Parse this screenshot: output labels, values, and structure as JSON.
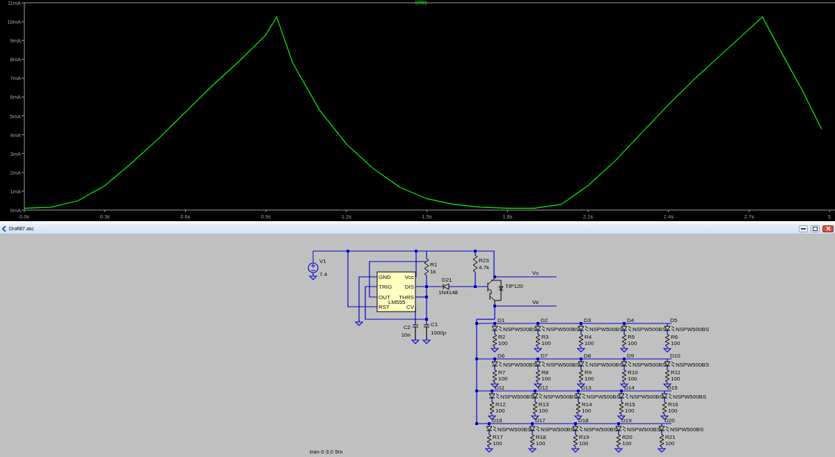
{
  "plot": {
    "chart_data": {
      "type": "line",
      "xlim": [
        0,
        3.02
      ],
      "ylim": [
        0,
        11
      ],
      "xticks": [
        {
          "value": 0,
          "label": "0.0s"
        },
        {
          "value": 0.3,
          "label": "0.3s"
        },
        {
          "value": 0.6,
          "label": "0.6s"
        },
        {
          "value": 0.9,
          "label": "0.9s"
        },
        {
          "value": 1.2,
          "label": "1.2s"
        },
        {
          "value": 1.5,
          "label": "1.5s"
        },
        {
          "value": 1.8,
          "label": "1.8s"
        },
        {
          "value": 2.1,
          "label": "2.1s"
        },
        {
          "value": 2.4,
          "label": "2.4s"
        },
        {
          "value": 2.7,
          "label": "2.7s"
        },
        {
          "value": 3.0,
          "label": "3."
        }
      ],
      "yticks": [
        {
          "value": 0,
          "label": "0mA"
        },
        {
          "value": 1,
          "label": "1mA"
        },
        {
          "value": 2,
          "label": "2mA"
        },
        {
          "value": 3,
          "label": "3mA"
        },
        {
          "value": 4,
          "label": "4mA"
        },
        {
          "value": 5,
          "label": "5mA"
        },
        {
          "value": 6,
          "label": "6mA"
        },
        {
          "value": 7,
          "label": "7mA"
        },
        {
          "value": 8,
          "label": "8mA"
        },
        {
          "value": 9,
          "label": "9mA"
        },
        {
          "value": 10,
          "label": "10mA"
        },
        {
          "value": 11,
          "label": "11mA"
        }
      ],
      "x": [
        0,
        0.1,
        0.2,
        0.3,
        0.4,
        0.5,
        0.6,
        0.7,
        0.8,
        0.9,
        0.94,
        1.0,
        1.1,
        1.2,
        1.3,
        1.4,
        1.5,
        1.6,
        1.7,
        1.8,
        1.9,
        2.0,
        2.1,
        2.2,
        2.3,
        2.4,
        2.5,
        2.6,
        2.7,
        2.75,
        2.8,
        2.9,
        2.97
      ],
      "series": [
        {
          "name": "I(Rb)",
          "color": "#00ff00",
          "values": [
            0.1,
            0.15,
            0.5,
            1.3,
            2.5,
            3.8,
            5.2,
            6.6,
            7.9,
            9.3,
            10.25,
            7.8,
            5.3,
            3.5,
            2.2,
            1.2,
            0.6,
            0.3,
            0.15,
            0.1,
            0.1,
            0.3,
            1.3,
            2.6,
            4.1,
            5.6,
            7.0,
            8.3,
            9.6,
            10.25,
            8.9,
            6.3,
            4.3
          ]
        }
      ]
    }
  },
  "schematic_window": {
    "title": "Draft87.asc",
    "source": {
      "designator": "V1",
      "value": "7.4"
    },
    "ic": {
      "part": "LM555",
      "left_pins": [
        "GND",
        "TRIG",
        "OUT",
        "RST"
      ],
      "right_pins": [
        "Vcc",
        "DIS",
        "THRS",
        "CV"
      ]
    },
    "r1": {
      "designator": "R1",
      "value": "1k"
    },
    "r23": {
      "designator": "R23",
      "value": "4.7k"
    },
    "diode": {
      "designator": "D21",
      "model": "1N4148"
    },
    "transistor": {
      "model": "TIP120"
    },
    "c1": {
      "designator": "C1",
      "value": "1000p"
    },
    "c2": {
      "designator": "C2",
      "value": "10n"
    },
    "net_labels": [
      "Vc",
      "Ve"
    ],
    "led_rows": [
      {
        "leds": [
          {
            "designator": "D1",
            "model": "NSPW500BS",
            "resistor": "R2",
            "value": "100"
          },
          {
            "designator": "D2",
            "model": "NSPW500BS",
            "resistor": "R3",
            "value": "100"
          },
          {
            "designator": "D3",
            "model": "NSPW500BS",
            "resistor": "R4",
            "value": "100"
          },
          {
            "designator": "D4",
            "model": "NSPW500BS",
            "resistor": "R5",
            "value": "100"
          },
          {
            "designator": "D5",
            "model": "NSPW500BS",
            "resistor": "R6",
            "value": "100"
          }
        ]
      },
      {
        "leds": [
          {
            "designator": "D6",
            "model": "NSPW500BS",
            "resistor": "R7",
            "value": "100"
          },
          {
            "designator": "D7",
            "model": "NSPW500BS",
            "resistor": "R8",
            "value": "100"
          },
          {
            "designator": "D8",
            "model": "NSPW500BS",
            "resistor": "R9",
            "value": "100"
          },
          {
            "designator": "D9",
            "model": "NSPW500BS",
            "resistor": "R10",
            "value": "100"
          },
          {
            "designator": "D10",
            "model": "NSPW500BS",
            "resistor": "R11",
            "value": "100"
          }
        ]
      },
      {
        "leds": [
          {
            "designator": "D11",
            "model": "NSPW500BS",
            "resistor": "R12",
            "value": "100"
          },
          {
            "designator": "D12",
            "model": "NSPW500BS",
            "resistor": "R13",
            "value": "100"
          },
          {
            "designator": "D13",
            "model": "NSPW500BS",
            "resistor": "R14",
            "value": "100"
          },
          {
            "designator": "D14",
            "model": "NSPW500BS",
            "resistor": "R15",
            "value": "100"
          },
          {
            "designator": "D15",
            "model": "NSPW500BS",
            "resistor": "R16",
            "value": "100"
          }
        ]
      },
      {
        "leds": [
          {
            "designator": "D16",
            "model": "NSPW500BS",
            "resistor": "R17",
            "value": "100"
          },
          {
            "designator": "D17",
            "model": "NSPW500BS",
            "resistor": "R18",
            "value": "100"
          },
          {
            "designator": "D18",
            "model": "NSPW500BS",
            "resistor": "R19",
            "value": "100"
          },
          {
            "designator": "D19",
            "model": "NSPW500BS",
            "resistor": "R20",
            "value": "100"
          },
          {
            "designator": "D20",
            "model": "NSPW500BS",
            "resistor": "R21",
            "value": "100"
          }
        ]
      }
    ],
    "directive": ".tran 0 3.0 5m"
  }
}
